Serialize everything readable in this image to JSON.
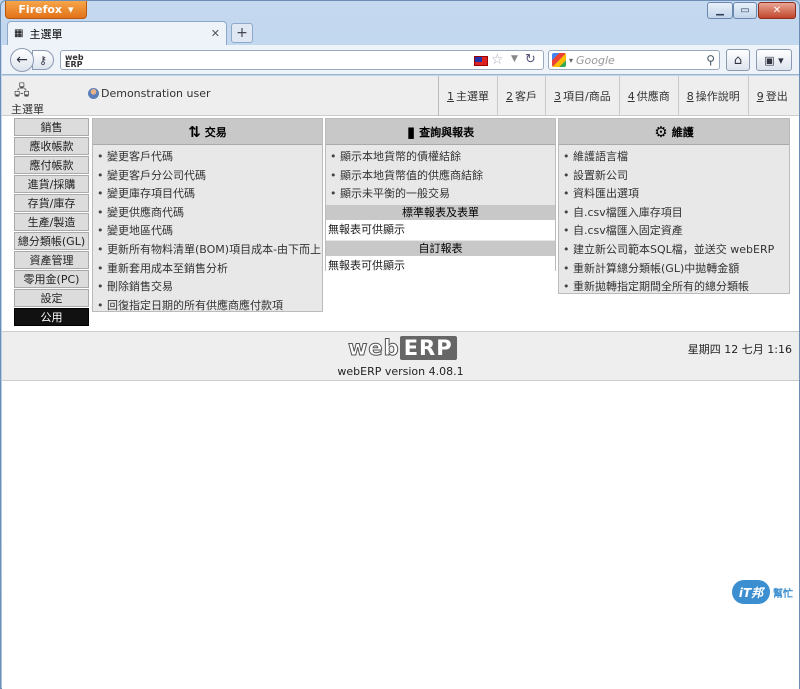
{
  "browser": {
    "app_button": "Firefox",
    "tab_title": "主選單",
    "search_placeholder": "Google",
    "window_controls": [
      "minimize-icon",
      "maximize-icon",
      "close-icon"
    ]
  },
  "header": {
    "title": "主選單",
    "user": "Demonstration user",
    "nav": [
      {
        "num": "1",
        "label": "主選單"
      },
      {
        "num": "2",
        "label": "客戶"
      },
      {
        "num": "3",
        "label": "項目/商品"
      },
      {
        "num": "4",
        "label": "供應商"
      },
      {
        "num": "8",
        "label": "操作說明"
      },
      {
        "num": "9",
        "label": "登出"
      }
    ]
  },
  "sidebar": {
    "items": [
      {
        "label": "銷售",
        "active": false
      },
      {
        "label": "應收帳款",
        "active": false
      },
      {
        "label": "應付帳款",
        "active": false
      },
      {
        "label": "進貨/採購",
        "active": false
      },
      {
        "label": "存貨/庫存",
        "active": false
      },
      {
        "label": "生產/製造",
        "active": false
      },
      {
        "label": "總分類帳(GL)",
        "active": false
      },
      {
        "label": "資產管理",
        "active": false
      },
      {
        "label": "零用金(PC)",
        "active": false
      },
      {
        "label": "設定",
        "active": false
      },
      {
        "label": "公用",
        "active": true
      }
    ]
  },
  "transactions": {
    "title": "交易",
    "items": [
      "變更客戶代碼",
      "變更客戶分公司代碼",
      "變更庫存項目代碼",
      "變更供應商代碼",
      "變更地區代碼",
      "更新所有物料清單(BOM)項目成本-由下而上",
      "重新套用成本至銷售分析",
      "刪除銷售交易",
      "回復指定日期的所有供應商應付款項"
    ]
  },
  "reports": {
    "title": "查詢與報表",
    "items": [
      "顯示本地貨幣的債權結餘",
      "顯示本地貨幣值的供應商結餘",
      "顯示未平衡的一般交易"
    ],
    "standard_title": "標準報表及表單",
    "standard_empty": "無報表可供顯示",
    "custom_title": "自訂報表",
    "custom_empty": "無報表可供顯示"
  },
  "maintenance": {
    "title": "維護",
    "items": [
      "維護語言檔",
      "設置新公司",
      "資料匯出選項",
      "自.csv檔匯入庫存項目",
      "自.csv檔匯入固定資產",
      "建立新公司範本SQL檔，並送交 webERP",
      "重新計算總分類帳(GL)中拋轉金額",
      "重新拋轉指定期間全所有的總分類帳"
    ]
  },
  "footer": {
    "logo_web": "web",
    "logo_erp": "ERP",
    "version": "webERP version 4.08.1",
    "datetime": "星期四 12 七月 1:16"
  },
  "watermark": {
    "mark": "iT邦",
    "text": "幫忙"
  }
}
